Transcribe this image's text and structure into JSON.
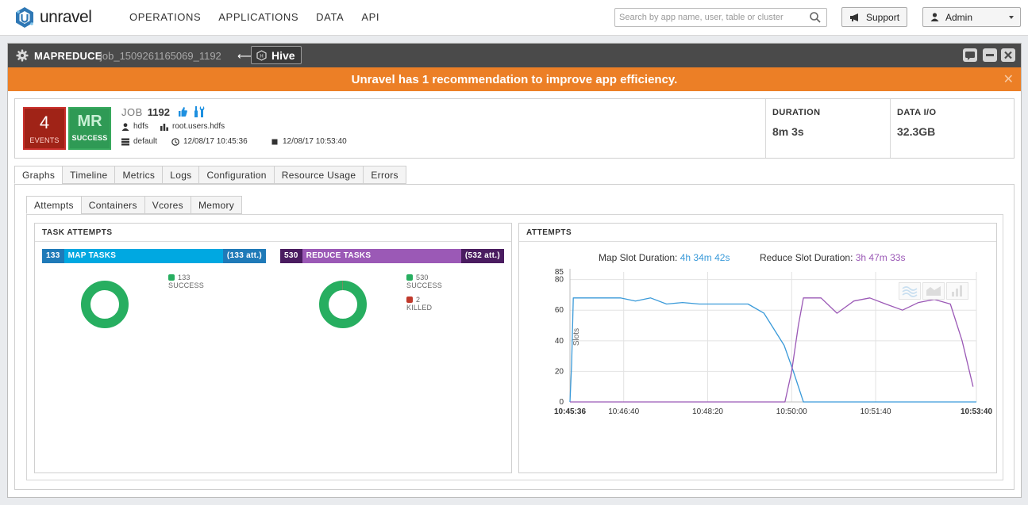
{
  "nav": {
    "brand": "unravel",
    "links": [
      "OPERATIONS",
      "APPLICATIONS",
      "DATA",
      "API"
    ],
    "search_placeholder": "Search by app name, user, table or cluster",
    "support_label": "Support",
    "admin_label": "Admin"
  },
  "titlebar": {
    "type": "MAPREDUCE",
    "job_id": "job_1509261165069_1192",
    "arrow": "⟵",
    "parent_label": "Hive"
  },
  "banner": {
    "text": "Unravel has 1 recommendation to improve app efficiency.",
    "close": "✕"
  },
  "summary": {
    "events_count": "4",
    "events_label": "EVENTS",
    "type_badge": "MR",
    "status_label": "SUCCESS",
    "job_word": "JOB",
    "job_number": "1192",
    "user": "hdfs",
    "queue": "root.users.hdfs",
    "database": "default",
    "start_time": "12/08/17 10:45:36",
    "end_time": "12/08/17 10:53:40",
    "duration_label": "DURATION",
    "duration_value": "8m 3s",
    "dataio_label": "DATA I/O",
    "dataio_value": "32.3GB"
  },
  "tabs": [
    "Graphs",
    "Timeline",
    "Metrics",
    "Logs",
    "Configuration",
    "Resource Usage",
    "Errors"
  ],
  "subtabs": [
    "Attempts",
    "Containers",
    "Vcores",
    "Memory"
  ],
  "task_attempts": {
    "title": "TASK ATTEMPTS",
    "map": {
      "count": "133",
      "label": "MAP TASKS",
      "attempts": "(133 att.)",
      "legend": [
        {
          "value": "133",
          "label": "SUCCESS"
        }
      ]
    },
    "reduce": {
      "count": "530",
      "label": "REDUCE TASKS",
      "attempts": "(532 att.)",
      "legend": [
        {
          "value": "530",
          "label": "SUCCESS"
        },
        {
          "value": "2",
          "label": "KILLED"
        }
      ]
    }
  },
  "attempts_chart": {
    "title": "ATTEMPTS",
    "map_slot_label": "Map Slot Duration:",
    "map_slot_value": "4h 34m 42s",
    "reduce_slot_label": "Reduce Slot Duration:",
    "reduce_slot_value": "3h 47m 33s"
  },
  "colors": {
    "map": "#3a9ad9",
    "reduce": "#9b59b6",
    "success": "#27ae60",
    "killed": "#c0392b",
    "banner": "#ec7f26"
  },
  "chart_data": [
    {
      "type": "pie",
      "categories": [
        "SUCCESS"
      ],
      "values": [
        133
      ]
    },
    {
      "type": "pie",
      "categories": [
        "SUCCESS",
        "KILLED"
      ],
      "values": [
        530,
        2
      ]
    },
    {
      "type": "line",
      "ylabel": "Slots",
      "ylim": [
        0,
        85
      ],
      "yticks": [
        0,
        20,
        40,
        60,
        80,
        85
      ],
      "xticks": [
        "10:45:36",
        "10:46:40",
        "10:48:20",
        "10:50:00",
        "10:51:40",
        "10:53:40"
      ],
      "x_seconds_ticks": [
        0,
        64,
        164,
        264,
        364,
        484
      ],
      "grid": true,
      "series": [
        {
          "name": "Map",
          "points": [
            [
              0,
              0
            ],
            [
              2,
              25
            ],
            [
              4,
              68
            ],
            [
              20,
              68
            ],
            [
              40,
              68
            ],
            [
              60,
              68
            ],
            [
              78,
              66
            ],
            [
              96,
              68
            ],
            [
              115,
              64
            ],
            [
              134,
              65
            ],
            [
              154,
              64
            ],
            [
              173,
              64
            ],
            [
              192,
              64
            ],
            [
              212,
              64
            ],
            [
              231,
              58
            ],
            [
              255,
              37
            ],
            [
              266,
              20
            ],
            [
              278,
              0
            ],
            [
              484,
              0
            ]
          ]
        },
        {
          "name": "Reduce",
          "points": [
            [
              0,
              0
            ],
            [
              256,
              0
            ],
            [
              264,
              20
            ],
            [
              272,
              50
            ],
            [
              278,
              68
            ],
            [
              299,
              68
            ],
            [
              318,
              58
            ],
            [
              338,
              66
            ],
            [
              357,
              68
            ],
            [
              376,
              64
            ],
            [
              396,
              60
            ],
            [
              415,
              65
            ],
            [
              434,
              67
            ],
            [
              453,
              64
            ],
            [
              467,
              40
            ],
            [
              480,
              10
            ]
          ]
        }
      ]
    }
  ]
}
